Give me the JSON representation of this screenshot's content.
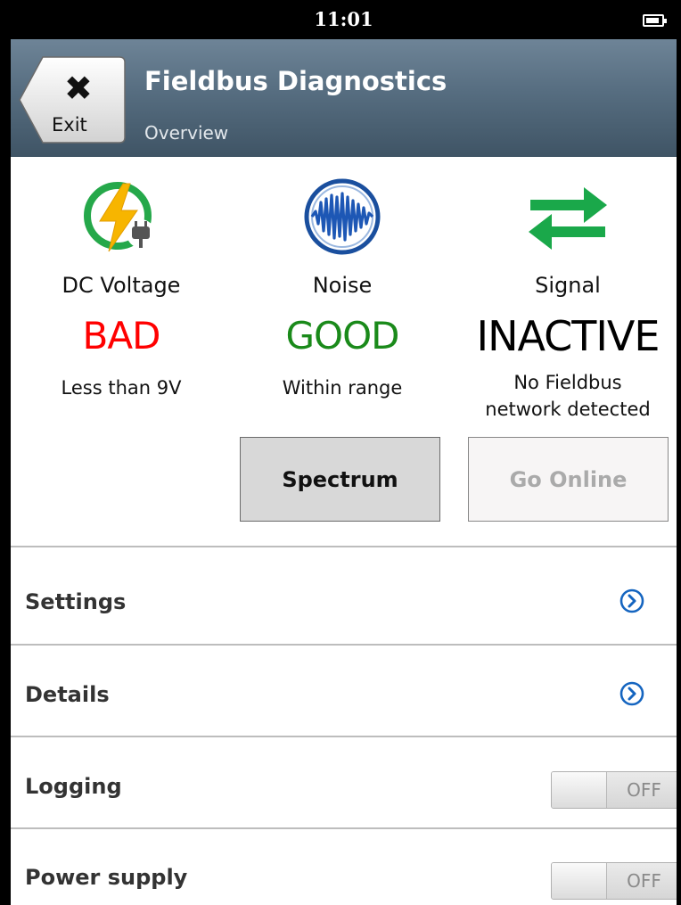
{
  "status_bar": {
    "time": "11:01",
    "battery_icon": "battery-icon"
  },
  "header": {
    "exit_label": "Exit",
    "exit_icon": "close-icon",
    "title": "Fieldbus Diagnostics",
    "subtitle": "Overview"
  },
  "indicators": [
    {
      "name": "DC Voltage",
      "status": "BAD",
      "description": "Less than 9V",
      "icon": "power-plug-icon",
      "status_color": "#ff0000"
    },
    {
      "name": "Noise",
      "status": "GOOD",
      "description": "Within range",
      "icon": "waveform-icon",
      "status_color": "#1a8a1a"
    },
    {
      "name": "Signal",
      "status": "INACTIVE",
      "description_line1": "No Fieldbus",
      "description_line2": "network detected",
      "icon": "exchange-arrows-icon",
      "status_color": "#000000"
    }
  ],
  "buttons": {
    "spectrum": "Spectrum",
    "go_online": "Go Online"
  },
  "list": {
    "settings": "Settings",
    "details": "Details",
    "logging": {
      "label": "Logging",
      "state": "OFF"
    },
    "power_supply": {
      "label": "Power supply",
      "state": "OFF"
    }
  },
  "colors": {
    "header": "#566d80",
    "accent_blue": "#1565c0",
    "good": "#1a8a1a",
    "bad": "#ff0000"
  }
}
